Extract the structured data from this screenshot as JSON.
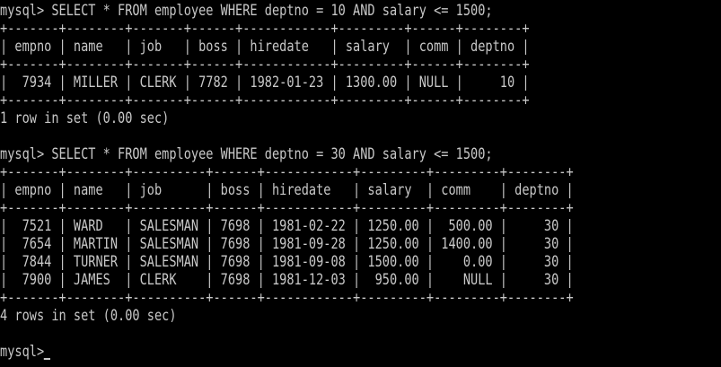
{
  "window": {
    "type": "terminal",
    "background_color": "#000000",
    "text_color": "#c8c8c8"
  },
  "terminal": {
    "lines": [
      "mysql> SELECT * FROM employee WHERE deptno = 10 AND salary <= 1500;",
      "+-------+--------+-------+------+------------+---------+------+--------+",
      "| empno | name   | job   | boss | hiredate   | salary  | comm | deptno |",
      "+-------+--------+-------+------+------------+---------+------+--------+",
      "|  7934 | MILLER | CLERK | 7782 | 1982-01-23 | 1300.00 | NULL |     10 |",
      "+-------+--------+-------+------+------------+---------+------+--------+",
      "1 row in set (0.00 sec)",
      "",
      "mysql> SELECT * FROM employee WHERE deptno = 30 AND salary <= 1500;",
      "+-------+--------+----------+------+------------+---------+---------+--------+",
      "| empno | name   | job      | boss | hiredate   | salary  | comm    | deptno |",
      "+-------+--------+----------+------+------------+---------+---------+--------+",
      "|  7521 | WARD   | SALESMAN | 7698 | 1981-02-22 | 1250.00 |  500.00 |     30 |",
      "|  7654 | MARTIN | SALESMAN | 7698 | 1981-09-28 | 1250.00 | 1400.00 |     30 |",
      "|  7844 | TURNER | SALESMAN | 7698 | 1981-09-08 | 1500.00 |    0.00 |     30 |",
      "|  7900 | JAMES  | CLERK    | 7698 | 1981-12-03 |  950.00 |    NULL |     30 |",
      "+-------+--------+----------+------+------------+---------+---------+--------+",
      "4 rows in set (0.00 sec)",
      "",
      "mysql>"
    ]
  }
}
